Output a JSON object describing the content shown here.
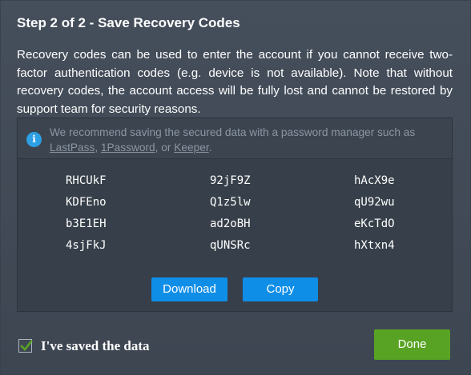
{
  "dialog": {
    "title": "Step 2 of 2 - Save Recovery Codes",
    "description": "Recovery codes can be used to enter the account if you cannot receive two-factor authentication codes (e.g. device is not available). Note that without recovery codes, the account access will be fully lost and cannot be restored by support team for security reasons."
  },
  "info": {
    "icon": "info-icon",
    "text_before": "We recommend saving the secured data with a password manager such as ",
    "link_lastpass": "LastPass",
    "sep1": ", ",
    "link_1password": "1Password",
    "sep2": ", or ",
    "link_keeper": "Keeper",
    "text_after": "."
  },
  "codes": [
    [
      "RHCUkF",
      "92jF9Z",
      "hAcX9e"
    ],
    [
      "KDFEno",
      "Q1z5lw",
      "qU92wu"
    ],
    [
      "b3E1EH",
      "ad2oBH",
      "eKcTdO"
    ],
    [
      "4sjFkJ",
      "qUNSRc",
      "hXtxn4"
    ]
  ],
  "buttons": {
    "download": "Download",
    "copy": "Copy",
    "done": "Done"
  },
  "confirm": {
    "label": "I've saved the data",
    "checked": true
  },
  "colors": {
    "background": "#414a56",
    "primary_button": "#0f8ee8",
    "done_button": "#59a324",
    "info_icon": "#2d9fe4",
    "check_mark": "#59a324"
  }
}
